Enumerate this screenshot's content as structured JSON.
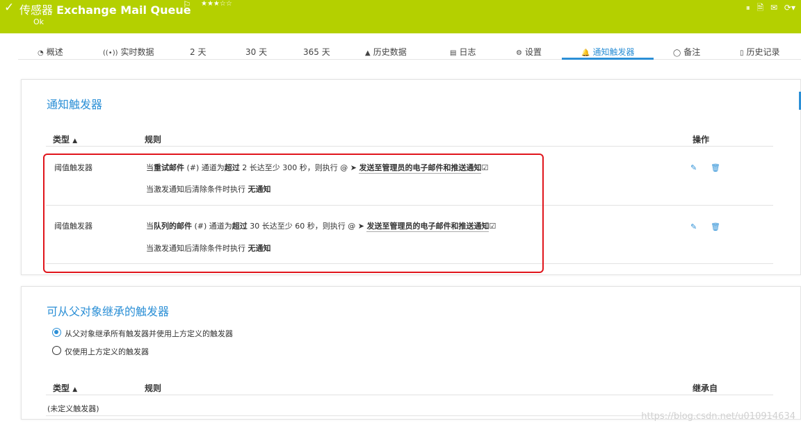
{
  "header": {
    "title_prefix": "传感器",
    "title_name": "Exchange Mail Queue",
    "flag_icon": "⚐",
    "stars": "★★★☆☆",
    "status": "Ok",
    "controls": [
      "⏸",
      "🗎",
      "✉",
      "⟳▾"
    ]
  },
  "tabs": [
    {
      "icon": "◔",
      "label": "概述"
    },
    {
      "icon": "((•))",
      "label": "实时数据"
    },
    {
      "icon": "",
      "label": "2  天"
    },
    {
      "icon": "",
      "label": "30  天"
    },
    {
      "icon": "",
      "label": "365  天"
    },
    {
      "icon": "▲",
      "label": "历史数据"
    },
    {
      "icon": "▤",
      "label": "日志"
    },
    {
      "icon": "⚙",
      "label": "设置"
    },
    {
      "icon": "🔔",
      "label": "通知触发器"
    },
    {
      "icon": "◯",
      "label": "备注"
    },
    {
      "icon": "▯",
      "label": "历史记录"
    }
  ],
  "triggers": {
    "title": "通知触发器",
    "col_type": "类型",
    "col_rule": "规则",
    "col_action": "操作",
    "rows": [
      {
        "type": "阈值触发器",
        "rule_a": "当",
        "rule_channel": "重试邮件",
        "rule_b": " (#) 通道为",
        "rule_cond": "超过",
        "rule_c": " 2 长达至少 300 秒，则执行 @ ➤ ",
        "rule_notify": "发送至管理员的电子邮件和推送通知",
        "clear_a": "当激发通知后清除条件时执行 ",
        "clear_b": "无通知"
      },
      {
        "type": "阈值触发器",
        "rule_a": "当",
        "rule_channel": "队列的邮件",
        "rule_b": " (#) 通道为",
        "rule_cond": "超过",
        "rule_c": " 30 长达至少 60 秒，则执行 @ ➤ ",
        "rule_notify": "发送至管理员的电子邮件和推送通知",
        "clear_a": "当激发通知后清除条件时执行 ",
        "clear_b": "无通知"
      }
    ]
  },
  "inherit": {
    "title": "可从父对象继承的触发器",
    "option1": "从父对象继承所有触发器并使用上方定义的触发器",
    "option2": "仅使用上方定义的触发器",
    "col_type": "类型",
    "col_rule": "规则",
    "col_from": "继承自",
    "empty": "(未定义触发器)"
  },
  "watermark": "https://blog.csdn.net/u010914634"
}
